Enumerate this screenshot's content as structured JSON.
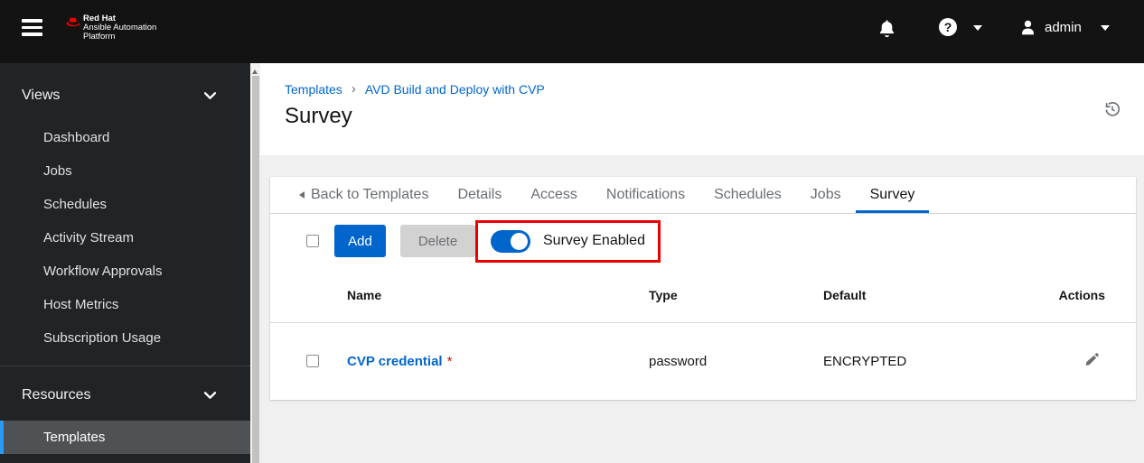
{
  "header": {
    "logo": {
      "line1": "Red Hat",
      "line2": "Ansible Automation",
      "line3": "Platform"
    },
    "icons": {
      "menu": "hamburger",
      "notifications": "bell",
      "help": "question-circle",
      "question_mark": "?",
      "user": "user-silhouette",
      "caret": "caret-down"
    },
    "user": {
      "name": "admin"
    }
  },
  "sidebar": {
    "sections": [
      {
        "label": "Views",
        "expanded": true,
        "items": [
          "Dashboard",
          "Jobs",
          "Schedules",
          "Activity Stream",
          "Workflow Approvals",
          "Host Metrics",
          "Subscription Usage"
        ]
      },
      {
        "label": "Resources",
        "expanded": true,
        "items": [
          "Templates"
        ],
        "selected": "Templates"
      }
    ]
  },
  "breadcrumb": [
    "Templates",
    "AVD Build and Deploy with CVP"
  ],
  "breadcrumb_separator": "›",
  "page_title": "Survey",
  "header_icons": {
    "history": "history-clock"
  },
  "tabs": {
    "back_label": "Back to Templates",
    "items": [
      "Details",
      "Access",
      "Notifications",
      "Schedules",
      "Jobs",
      "Survey"
    ],
    "active": "Survey"
  },
  "toolbar": {
    "select_all_checked": false,
    "add_label": "Add",
    "delete_label": "Delete",
    "delete_disabled": true,
    "toggle_label": "Survey Enabled",
    "toggle_on": true,
    "annotation": "red highlight box around survey toggle"
  },
  "table": {
    "columns": [
      "Name",
      "Type",
      "Default",
      "Actions"
    ],
    "rows": [
      {
        "checked": false,
        "name": "CVP credential",
        "required_marker": "*",
        "type": "password",
        "default": "ENCRYPTED",
        "action_icon": "pencil"
      }
    ]
  },
  "colors": {
    "accent_blue": "#0066cc",
    "annotation_red": "#ec0000",
    "required_red": "#c9190b",
    "masthead_bg": "#131313",
    "sidebar_bg": "#212427",
    "sidebar_selected_bg": "#4f5255",
    "sidebar_selected_border": "#2b9af3",
    "content_bg": "#f0f0f0",
    "muted_text": "#6a6e73",
    "brand_red": "#ee0000"
  }
}
